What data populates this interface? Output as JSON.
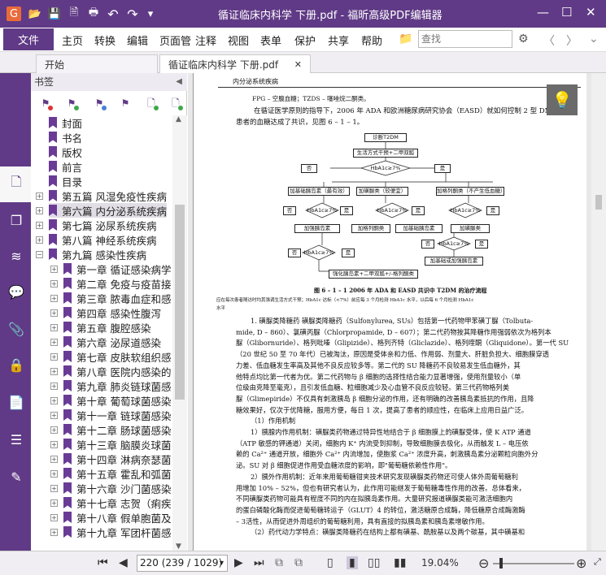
{
  "window": {
    "title": "循证临床内科学  下册.pdf - 福昕高级PDF编辑器",
    "minimize": "—",
    "maximize": "☐",
    "close": "✕"
  },
  "quick_access": {
    "open": "📂",
    "save": "💾",
    "save_as": "🗎",
    "print": "🖶",
    "undo": "↶",
    "redo": "↷",
    "customize": "▾"
  },
  "menu": {
    "file": "文件",
    "items": [
      "主页",
      "转换",
      "编辑",
      "页面管",
      "注释",
      "视图",
      "表单",
      "保护",
      "共享",
      "帮助"
    ],
    "search_placeholder": "查找",
    "folder_icon": "📁",
    "gear_icon": "⚙",
    "prev_icon": "〈",
    "next_icon": "〉",
    "expand_icon": "⌄"
  },
  "tabs": [
    {
      "label": "开始",
      "active": false
    },
    {
      "label": "循证临床内科学  下册.pdf",
      "active": true,
      "close": "✕"
    }
  ],
  "left_strip": {
    "page_icon": "🗋",
    "thumbnails_icon": "❐",
    "layers_icon": "≋",
    "comments_icon": "💬",
    "attachments_icon": "📎",
    "security_icon": "🔒",
    "pages_icon": "📄",
    "forms_icon": "☰",
    "pen_icon": "✎"
  },
  "bookmarks": {
    "header": "书签",
    "collapse": "◀",
    "items": [
      {
        "label": "封面",
        "level": 0,
        "expandable": false
      },
      {
        "label": "书名",
        "level": 0,
        "expandable": false
      },
      {
        "label": "版权",
        "level": 0,
        "expandable": false
      },
      {
        "label": "前言",
        "level": 0,
        "expandable": false
      },
      {
        "label": "目录",
        "level": 0,
        "expandable": false
      },
      {
        "label": "第五篇  风湿免疫性疾病",
        "level": 0,
        "expandable": true
      },
      {
        "label": "第六篇  内分泌系统疾病",
        "level": 0,
        "expandable": true,
        "selected": true
      },
      {
        "label": "第七篇  泌尿系统疾病",
        "level": 0,
        "expandable": true
      },
      {
        "label": "第八篇  神经系统疾病",
        "level": 0,
        "expandable": true
      },
      {
        "label": "第九篇  感染性疾病",
        "level": 0,
        "expandable": true,
        "expanded": true
      },
      {
        "label": "第一章  循证感染病学",
        "level": 1,
        "expandable": true
      },
      {
        "label": "第二章  免疫与疫苗接",
        "level": 1,
        "expandable": true
      },
      {
        "label": "第三章  脓毒血症和感",
        "level": 1,
        "expandable": true
      },
      {
        "label": "第四章  感染性腹泻",
        "level": 1,
        "expandable": true
      },
      {
        "label": "第五章  腹腔感染",
        "level": 1,
        "expandable": true
      },
      {
        "label": "第六章  泌尿道感染",
        "level": 1,
        "expandable": true
      },
      {
        "label": "第七章  皮肤软组织感",
        "level": 1,
        "expandable": true
      },
      {
        "label": "第八章  医院内感染的",
        "level": 1,
        "expandable": true
      },
      {
        "label": "第九章  肺炎链球菌感",
        "level": 1,
        "expandable": true
      },
      {
        "label": "第十章  葡萄球菌感染",
        "level": 1,
        "expandable": true
      },
      {
        "label": "第十一章  链球菌感染",
        "level": 1,
        "expandable": true
      },
      {
        "label": "第十二章  肠球菌感染",
        "level": 1,
        "expandable": true
      },
      {
        "label": "第十三章  脑膜炎球菌",
        "level": 1,
        "expandable": true
      },
      {
        "label": "第十四章  淋病奈瑟菌",
        "level": 1,
        "expandable": true
      },
      {
        "label": "第十五章  霍乱和弧菌",
        "level": 1,
        "expandable": true
      },
      {
        "label": "第十六章  沙门菌感染",
        "level": 1,
        "expandable": true
      },
      {
        "label": "第十七章  志贺（痢疾",
        "level": 1,
        "expandable": true
      },
      {
        "label": "第十八章  假单胞菌及",
        "level": 1,
        "expandable": true
      },
      {
        "label": "第十九章  军团杆菌感",
        "level": 1,
        "expandable": true
      }
    ]
  },
  "document": {
    "running_head": "内分泌系统疾病",
    "lines": [
      "FPG – 空腹血糖；TZDS – 噻唑烷二酮类。",
      "在循证医学原则的指导下，2006 年 ADA 和欧洲糖尿病研究协会（EASD）就如何控制 2 型 DM",
      "患者的血糖达成了共识，见图 6 – 1 – 1。"
    ],
    "flowchart": {
      "diagnose": "诊断T2DM",
      "lifestyle": "生活方式干预+二甲双胍",
      "hba1c": "HbA1c≥7%",
      "no": "否",
      "yes": "是",
      "basal_insulin": "加基础胰岛素（最有效）",
      "sulfonylurea": "加磺脲类（较便宜）",
      "glitazone": "加格列酮类（不产生低血糖）",
      "intensify_insulin": "加强胰岛素",
      "glitazone2": "加格列酮类",
      "basal_insulin2": "加基础胰岛素",
      "sulfonylurea2": "加磺脲类",
      "basal_intensify": "加基础或加强胰岛素",
      "final": "强化胰岛素+二甲双胍+/-格列酮类"
    },
    "figure_caption": "图 6 – 1 – 1    2006 年 ADA 和 EASD 共识中 T2DM 的治疗流程",
    "figure_note": "应在每次患者随访时均其强调生活方式干预；HbA1c 达标（<7%）前应每 3 个月检测 HbA1c 水平，以后每 6 个月检测 HbA1c",
    "figure_note2": "水平",
    "body": [
      "1. 磺脲类降糖药    磺脲类降糖药（Sulfonylurea, SUs）包括第一代药物甲苯磺丁脲（Tolbuta-",
      "mide, D – 860）、氯磺丙脲（Chlorpropamide, D – 607）；第二代药物按其降糖作用强弱依次为格列本",
      "脲（Glibornuride）、格列吡嗪（Glipizide）、格列齐特（Gliclazide）、格列喹酮（Gliquidone）。第一代 SU",
      "（20 世纪 50 至 70 年代）已被淘汰，原因是受体亲和力低、作用弱、剂量大、肝脏负担大、细胞膜穿透",
      "力差、低血糖发生率高及其他不良反应较多等。第二代的 SU 降糖药不良较易发生低血糖外，其",
      "他特点均比第一代者为优。第二代药物与 β 细胞的选择性结合能力显著增强，使用剂量较小（单",
      "位级由克降至毫克），且引发低血糖、粒细胞减少及心血管不良反应较轻。第三代药物格列美",
      "脲（Glimepiride）不仅具有刺激胰岛 β 细胞分泌的作用，还有明确的改善胰岛素抵抗的作用，且降",
      "糖效果好，仅次于优降糖，服用方便，每日 1 次，提高了患者的顺应性，在临床上应用日益广泛。",
      "（1）作用机制",
      "1）胰腺内作用机制：磺脲类药物通过特异性地结合于 β 细胞膜上的磺脲受体，使 K ATP 通道",
      "（ATP 敏感的钾通道）关闭，细胞内 K⁺ 内流受到抑制，导致细胞膜去极化，从而触发 L – 电压依",
      "赖的 Ca²⁺ 通道开放，细胞外 Ca²⁺ 内流增加，使胞浆 Ca²⁺ 浓度升高，刺激胰岛素分泌颗粒向胞外分",
      "泌。SU 对 β 细胞促进作用受血糖浓度的影响，即\"葡萄糖依赖性作用\"。",
      "2）胰外作用机制：近年来用葡萄糖钳夹技术研究发现磺脲类药物还可使人体外周葡萄糖利",
      "用增加 10% – 52%，但也有研究者认为，此作用可能继发于葡萄糖毒性作用的改善。总体看来，",
      "不同磺脲类药物可能具有程度不同的内在拟胰岛素作用。大量研究报道磺脲类能可激活细胞内",
      "的蛋白磷酸化酶而促进葡萄糖转运子（GLUT）4 的转位，激活糖原合成酶，降低糖原合成酶激酶",
      "– 3活性，从而促进外周组织的葡萄糖利用，具有直接的拟胰岛素和胰岛素增敏作用。",
      "（2）药代动力学特点：磺脲类降糖药在结构上都有磺基、酰胺基以及两个碳基，其中磺基和"
    ],
    "tip_icon": "💡"
  },
  "statusbar": {
    "first": "⏮",
    "prev": "◀",
    "page": "220 (239 / 1029)",
    "dropdown": "▾",
    "next": "▶",
    "last": "⏭",
    "zoom": "19.04%",
    "zoom_out": "⊖",
    "zoom_in": "⊕",
    "fit": "⤢"
  }
}
